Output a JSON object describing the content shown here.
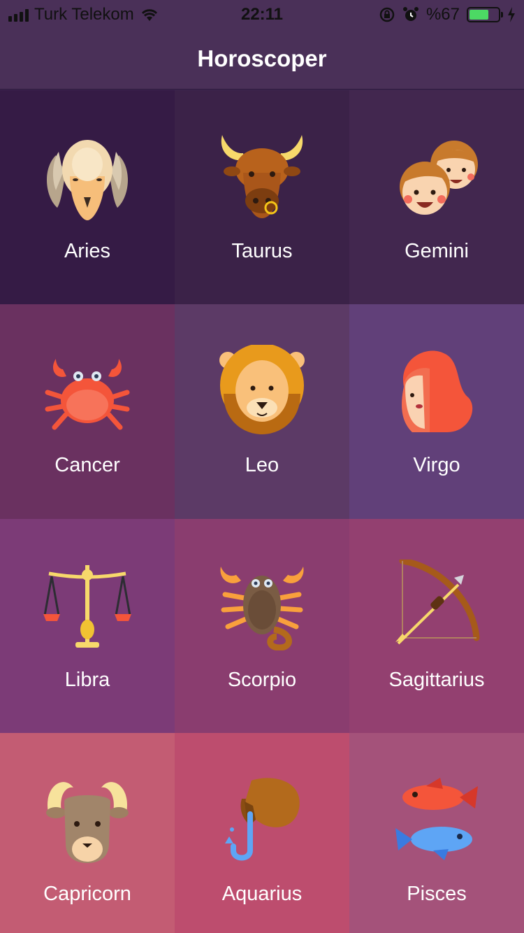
{
  "status_bar": {
    "carrier": "Turk Telekom",
    "time": "22:11",
    "battery": "%67",
    "battery_level": 0.67,
    "icons": [
      "signal-icon",
      "wifi-icon",
      "rotation-lock-icon",
      "alarm-icon",
      "battery-icon",
      "charging-icon"
    ]
  },
  "nav": {
    "title": "Horoscoper"
  },
  "signs": [
    {
      "name": "Aries",
      "bg": "#351b45",
      "icon": "ram-icon"
    },
    {
      "name": "Taurus",
      "bg": "#3b2248",
      "icon": "bull-icon"
    },
    {
      "name": "Gemini",
      "bg": "#42274f",
      "icon": "twins-icon"
    },
    {
      "name": "Cancer",
      "bg": "#6a3160",
      "icon": "crab-icon"
    },
    {
      "name": "Leo",
      "bg": "#5c3a66",
      "icon": "lion-icon"
    },
    {
      "name": "Virgo",
      "bg": "#614079",
      "icon": "maiden-icon"
    },
    {
      "name": "Libra",
      "bg": "#7c3b77",
      "icon": "scales-icon"
    },
    {
      "name": "Scorpio",
      "bg": "#8a3d6f",
      "icon": "scorpion-icon"
    },
    {
      "name": "Sagittarius",
      "bg": "#934070",
      "icon": "bow-arrow-icon"
    },
    {
      "name": "Capricorn",
      "bg": "#c35c73",
      "icon": "goat-icon"
    },
    {
      "name": "Aquarius",
      "bg": "#bd4d6e",
      "icon": "water-jar-icon"
    },
    {
      "name": "Pisces",
      "bg": "#a4527a",
      "icon": "fish-icon"
    }
  ]
}
